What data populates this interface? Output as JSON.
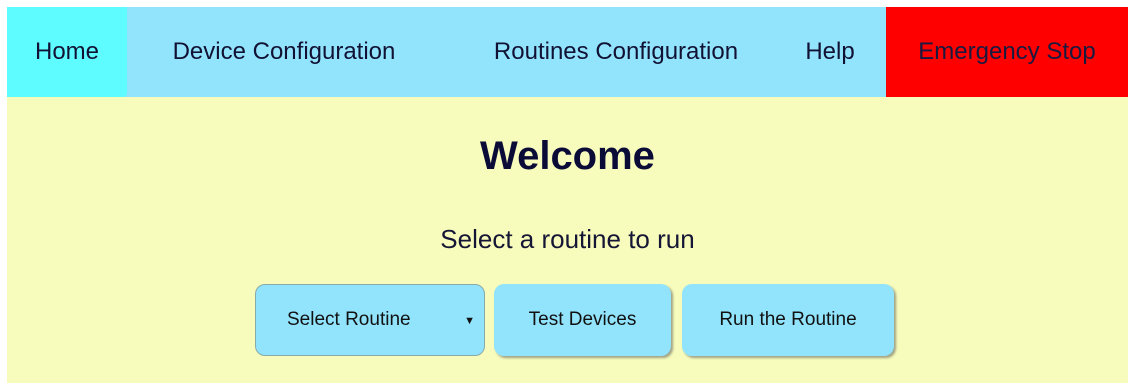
{
  "nav": {
    "home": "Home",
    "device_configuration": "Device Configuration",
    "routines_configuration": "Routines Configuration",
    "help": "Help",
    "emergency_stop": "Emergency Stop"
  },
  "main": {
    "title": "Welcome",
    "subtitle": "Select a routine to run"
  },
  "controls": {
    "routine_select": {
      "selected": "Select Routine",
      "icon": "triangle-down"
    },
    "test_devices": "Test Devices",
    "run_routine": "Run the Routine"
  },
  "colors": {
    "nav_background": "#92e4fd",
    "home_active": "#5ffcff",
    "emergency_stop": "#fe0000",
    "page_background": "#f7fbbb",
    "button_background": "#92e4fd"
  }
}
